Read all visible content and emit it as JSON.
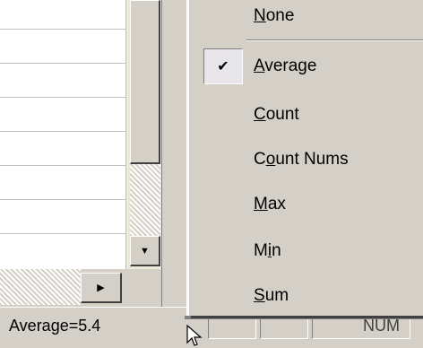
{
  "context_menu": {
    "items": [
      {
        "label": "None",
        "mnemonic_index": 0,
        "checked": false
      },
      {
        "label": "Average",
        "mnemonic_index": 0,
        "checked": true
      },
      {
        "label": "Count",
        "mnemonic_index": 0,
        "checked": false
      },
      {
        "label": "Count Nums",
        "mnemonic_index": 1,
        "checked": false
      },
      {
        "label": "Max",
        "mnemonic_index": 0,
        "checked": false
      },
      {
        "label": "Min",
        "mnemonic_index": 1,
        "checked": false
      },
      {
        "label": "Sum",
        "mnemonic_index": 0,
        "checked": false
      }
    ],
    "check_glyph": "✔"
  },
  "status_bar": {
    "summary_text": "Average=5.4",
    "mode_indicator": "NUM"
  },
  "scrollbar": {
    "down_arrow_glyph": "▼",
    "right_arrow_glyph": "▶"
  },
  "icons": {
    "cursor": "mouse-pointer-icon"
  }
}
